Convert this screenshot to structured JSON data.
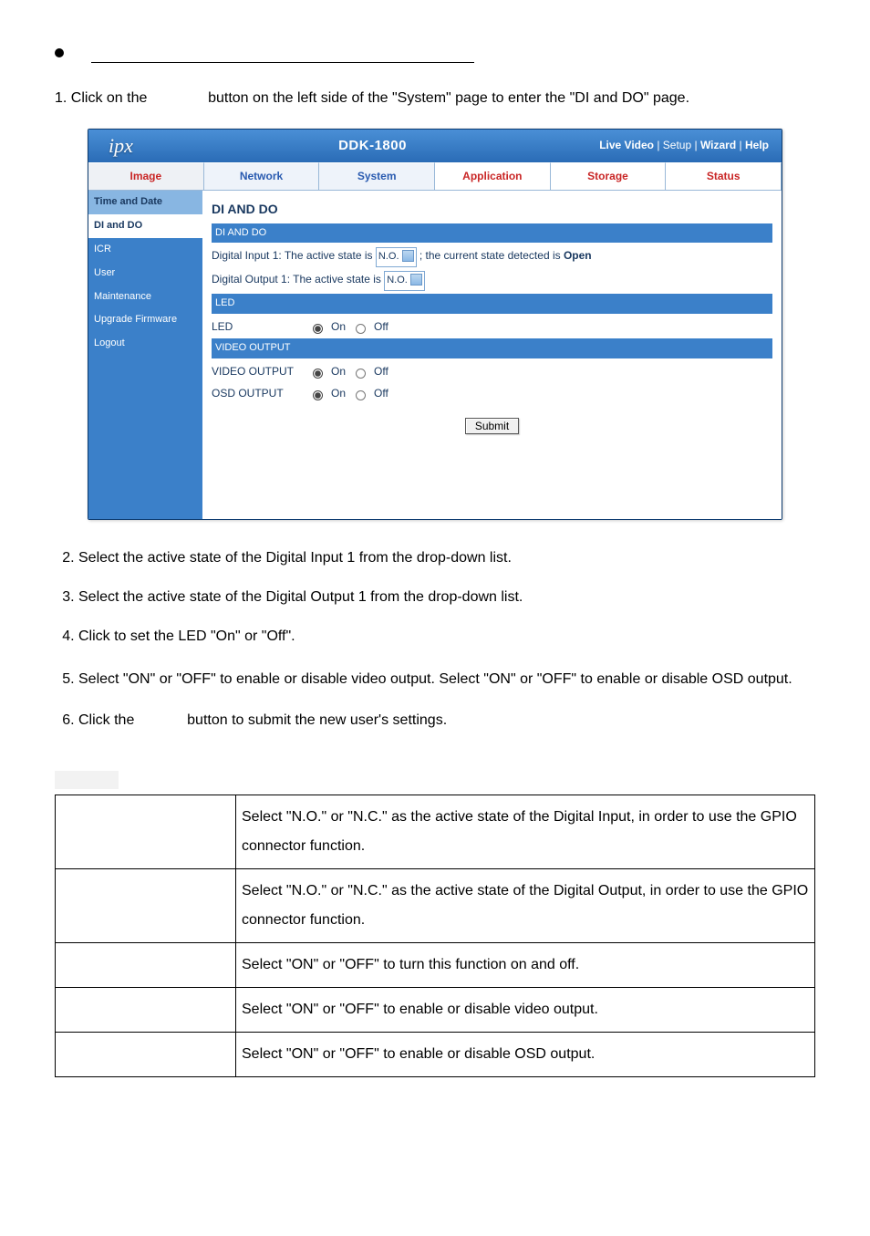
{
  "intro": {
    "pre": "1.  Click on the",
    "post": "button on the left side of the \"System\" page to enter the \"DI and DO\" page."
  },
  "screenshot": {
    "logo": "ipx",
    "title": "DDK-1800",
    "toplinks": {
      "live": "Live Video",
      "setup": "Setup",
      "wizard": "Wizard",
      "help": "Help"
    },
    "tabs": [
      "Image",
      "Network",
      "System",
      "Application",
      "Storage",
      "Status"
    ],
    "side": [
      "Time and Date",
      "DI and DO",
      "ICR",
      "User",
      "Maintenance",
      "Upgrade Firmware",
      "Logout"
    ],
    "main": {
      "h1": "DI AND DO",
      "sec1": "DI AND DO",
      "di_text_a": "Digital Input  1: The active state is",
      "di_sel": "N.O.",
      "di_text_b": "; the current state detected is",
      "di_state": "Open",
      "do_text": "Digital Output 1: The active state is",
      "do_sel": "N.O.",
      "sec2": "LED",
      "led_label": "LED",
      "sec3": "VIDEO OUTPUT",
      "vo_label": "VIDEO OUTPUT",
      "osd_label": "OSD OUTPUT",
      "on": "On",
      "off": "Off",
      "submit": "Submit"
    }
  },
  "steps": [
    "Select the active state of the Digital Input 1 from the drop-down list.",
    "Select the active state of the Digital Output 1 from the drop-down list.",
    "Click to set the LED \"On\" or \"Off\".",
    "Select \"ON\" or \"OFF\" to enable or disable video output. Select \"ON\" or \"OFF\" to enable or disable OSD output."
  ],
  "step6": {
    "pre": "Click the",
    "post": "button to submit the new user's settings."
  },
  "desc": [
    "Select \"N.O.\" or \"N.C.\" as the active state of the Digital Input, in order to use the GPIO connector function.",
    "Select \"N.O.\" or \"N.C.\" as the active state of the Digital Output, in order to use the GPIO connector function.",
    "Select \"ON\" or \"OFF\" to turn this function on and off.",
    "Select \"ON\" or \"OFF\" to enable or disable video output.",
    "Select \"ON\" or \"OFF\" to enable or disable OSD output."
  ]
}
